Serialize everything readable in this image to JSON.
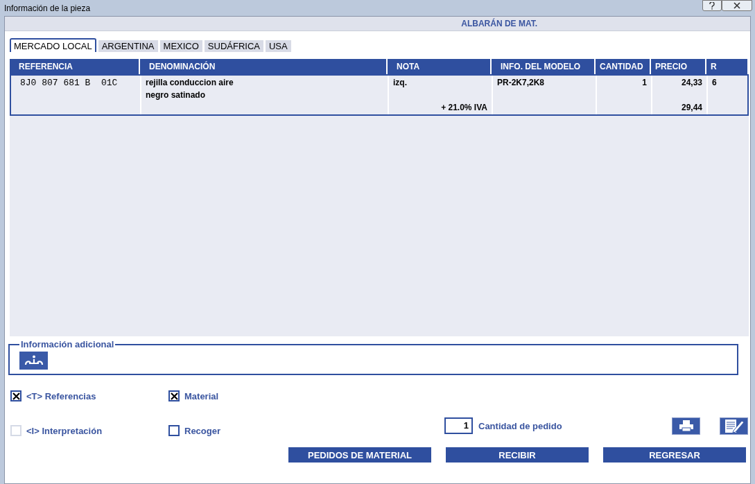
{
  "window": {
    "title": "Información de la pieza"
  },
  "header": {
    "title": "ALBARÁN DE MAT."
  },
  "tabs": [
    {
      "label": "MERCADO LOCAL",
      "selected": true
    },
    {
      "label": "ARGENTINA",
      "selected": false
    },
    {
      "label": "MEXICO",
      "selected": false
    },
    {
      "label": "SUDÁFRICA",
      "selected": false
    },
    {
      "label": "USA",
      "selected": false
    }
  ],
  "table": {
    "columns": [
      "REFERENCIA",
      "DENOMINACIÓN",
      "NOTA",
      "INFO. DEL MODELO",
      "CANTIDAD",
      "PRECIO",
      "R"
    ],
    "rows": [
      {
        "referencia": "8J0 807 681 B  01C",
        "denominacion": [
          "rejilla conduccion aire",
          "negro satinado"
        ],
        "nota": "izq.",
        "iva": "+ 21.0% IVA",
        "info_modelo": "PR-2K7,2K8",
        "cantidad": "1",
        "precio": "24,33",
        "precio_iva": "29,44",
        "r": "6"
      }
    ]
  },
  "additional_info": {
    "title": "Información adicional"
  },
  "options": [
    {
      "label": "<T> Referencias",
      "checked": true,
      "disabled": false
    },
    {
      "label": "Material",
      "checked": true,
      "disabled": false
    },
    {
      "label": "<I> Interpretación",
      "checked": false,
      "disabled": true
    },
    {
      "label": "Recoger",
      "checked": false,
      "disabled": false
    }
  ],
  "order_quantity": {
    "value": "1",
    "label": "Cantidad de pedido"
  },
  "buttons": [
    "PEDIDOS DE MATERIAL",
    "RECIBIR",
    "REGRESAR"
  ]
}
